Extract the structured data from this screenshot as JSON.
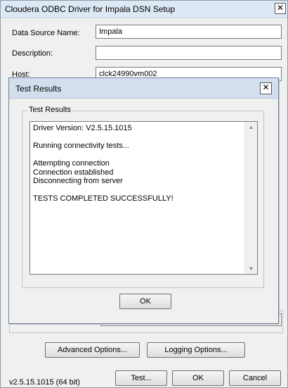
{
  "window": {
    "title": "Cloudera ODBC Driver for Impala DSN Setup",
    "close_glyph": "✕"
  },
  "fields": {
    "dsn_label": "Data Source Name:",
    "dsn_value": "Impala",
    "description_label": "Description:",
    "description_value": "",
    "host_label": "Host:",
    "host_value": "clck24990vm002"
  },
  "buttons": {
    "advanced": "Advanced Options...",
    "logging": "Logging Options...",
    "test": "Test...",
    "ok": "OK",
    "cancel": "Cancel"
  },
  "version": "v2.5.15.1015 (64 bit)",
  "dialog": {
    "title": "Test Results",
    "close_glyph": "✕",
    "group_label": "Test Results",
    "lines": [
      "Driver Version: V2.5.15.1015",
      "",
      "Running connectivity tests...",
      "",
      "Attempting connection",
      "Connection established",
      "Disconnecting from server",
      "",
      "TESTS COMPLETED SUCCESSFULLY!"
    ],
    "ok": "OK"
  }
}
